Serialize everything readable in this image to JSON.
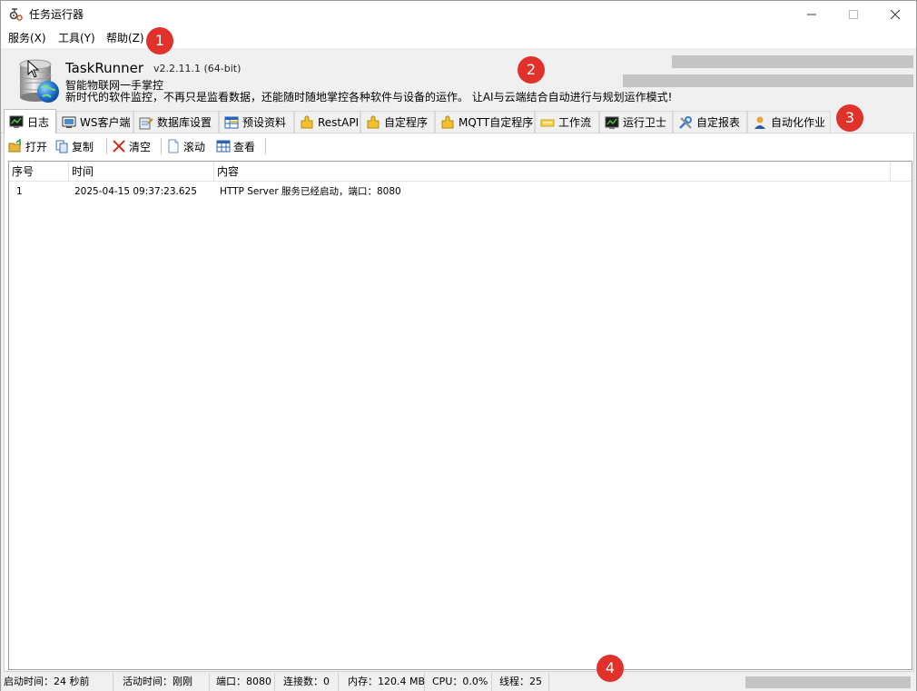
{
  "window": {
    "title": "任务运行器"
  },
  "menu": [
    "服务(X)",
    "工具(Y)",
    "帮助(Z)"
  ],
  "header": {
    "app_name": "TaskRunner",
    "version": "v2.2.11.1 (64-bit)",
    "tagline1": "智能物联网一手掌控",
    "tagline2": "新时代的软件监控，不再只是监看数据，还能随时随地掌控各种软件与设备的运作。 让AI与云端结合自动进行与规划运作模式!"
  },
  "markers": [
    "1",
    "2",
    "3",
    "4"
  ],
  "tabs": [
    {
      "label": "日志",
      "icon": "monitor-chart-icon",
      "active": true
    },
    {
      "label": "WS客户端",
      "icon": "computer-icon"
    },
    {
      "label": "数据库设置",
      "icon": "database-settings-icon"
    },
    {
      "label": "预设资料",
      "icon": "table-icon"
    },
    {
      "label": "RestAPI",
      "icon": "puzzle-icon"
    },
    {
      "label": "自定程序",
      "icon": "puzzle-icon"
    },
    {
      "label": "MQTT自定程序",
      "icon": "puzzle-icon"
    },
    {
      "label": "工作流",
      "icon": "workflow-icon"
    },
    {
      "label": "运行卫士",
      "icon": "monitor-chart-icon"
    },
    {
      "label": "自定报表",
      "icon": "tools-icon"
    },
    {
      "label": "自动化作业",
      "icon": "person-icon"
    }
  ],
  "toolbar": {
    "open": "打开",
    "copy": "复制",
    "clear": "清空",
    "scroll": "滚动",
    "view": "查看"
  },
  "log": {
    "columns": [
      "序号",
      "时间",
      "内容"
    ],
    "rows": [
      {
        "seq": "1",
        "time": "2025-04-15 09:37:23.625",
        "content": "HTTP Server 服务已经启动，端口：8080"
      }
    ]
  },
  "status": {
    "uptime": "启动时间：24 秒前",
    "active": "活动时间：刚刚",
    "port": "端口：8080",
    "connections": "连接数：0",
    "memory": "内存：120.4 MB",
    "cpu": "CPU：0.0%",
    "threads": "线程：25"
  },
  "colors": {
    "marker": "#e0322b",
    "accent_blue": "#1e6fd1",
    "chrome": "#f0f0f0"
  }
}
